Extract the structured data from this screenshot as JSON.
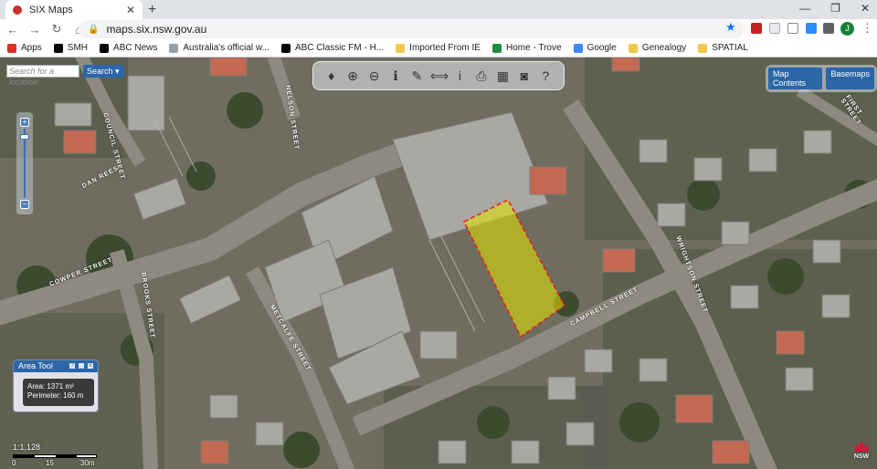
{
  "browser": {
    "tab_title": "SIX Maps",
    "url": "maps.six.nsw.gov.au",
    "profile_initial": "J"
  },
  "bookmarks": [
    {
      "label": "Apps",
      "color": "#d93025"
    },
    {
      "label": "SMH",
      "color": "#000000"
    },
    {
      "label": "ABC News",
      "color": "#000000"
    },
    {
      "label": "Australia's official w...",
      "color": "#9aa0a6"
    },
    {
      "label": "ABC Classic FM - H...",
      "color": "#000000"
    },
    {
      "label": "Imported From IE",
      "color": "#f2c94c"
    },
    {
      "label": "Home - Trove",
      "color": "#1e8e3e"
    },
    {
      "label": "Google",
      "color": "#4285f4"
    },
    {
      "label": "Genealogy",
      "color": "#f2c94c"
    },
    {
      "label": "SPATIAL",
      "color": "#f2c94c"
    }
  ],
  "map": {
    "search_placeholder": "Search for a location",
    "search_button": "Search",
    "map_contents_button": "Map Contents",
    "basemaps_button": "Basemaps",
    "streets": {
      "council": "COUNCIL STREET",
      "dan_rees": "DAN REES",
      "cowper": "COWPER STREET",
      "brooks": "BROOKS STREET",
      "metcalfe": "METCALFE STREET",
      "campbell": "CAMPBELL STREET",
      "wrightson": "WRIGHTSON STREET",
      "nelson": "NELSON STREET",
      "first": "FIRST STREET"
    },
    "tools": [
      {
        "icon": "fire-icon",
        "glyph": "♦"
      },
      {
        "icon": "zoom-in-icon",
        "glyph": "⊕"
      },
      {
        "icon": "zoom-out-icon",
        "glyph": "⊖"
      },
      {
        "icon": "identify-icon",
        "glyph": "ℹ"
      },
      {
        "icon": "draw-icon",
        "glyph": "✎"
      },
      {
        "icon": "measure-icon",
        "glyph": "⟺"
      },
      {
        "icon": "info-icon",
        "glyph": "i"
      },
      {
        "icon": "print-icon",
        "glyph": "⎙"
      },
      {
        "icon": "table-icon",
        "glyph": "▦"
      },
      {
        "icon": "camera-icon",
        "glyph": "◙"
      },
      {
        "icon": "help-icon",
        "glyph": "?"
      }
    ],
    "area_tool": {
      "title": "Area Tool",
      "area_label": "Area: 1371 m²",
      "perimeter_label": "Perimeter: 160 m"
    },
    "scale": {
      "ratio": "1:1,128",
      "labels": [
        "0",
        "15",
        "30m"
      ]
    },
    "logo_text": "NSW",
    "highlight_color": "#e6e600"
  }
}
